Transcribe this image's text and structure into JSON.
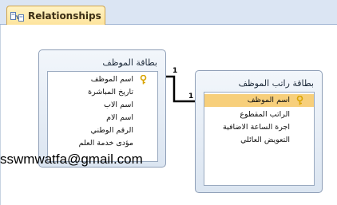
{
  "tab": {
    "label": "Relationships",
    "icon": "relationships-icon"
  },
  "tables": [
    {
      "title": "بطاقة الموظف",
      "fields": [
        {
          "label": "اسم الموظف",
          "primary_key": true
        },
        {
          "label": "تاريخ المباشرة"
        },
        {
          "label": "اسم الاب"
        },
        {
          "label": "اسم الام"
        },
        {
          "label": "الرقم الوطني"
        },
        {
          "label": "مؤدى خدمة العلم"
        }
      ]
    },
    {
      "title": "بطاقة راتب الموظف",
      "fields": [
        {
          "label": "اسم الموظف",
          "primary_key": true,
          "selected": true
        },
        {
          "label": "الراتب المقطوع"
        },
        {
          "label": "اجرة الساعة الاضافية"
        },
        {
          "label": "التعويض العائلي"
        }
      ]
    }
  ],
  "relationship": {
    "from_label": "1",
    "to_label": "1"
  },
  "watermark": "sswmwatfa@gmail.com",
  "colors": {
    "selected_row": "#f7cf7b",
    "tab_bg": "#fde39b",
    "key_icon": "#d9a400"
  }
}
